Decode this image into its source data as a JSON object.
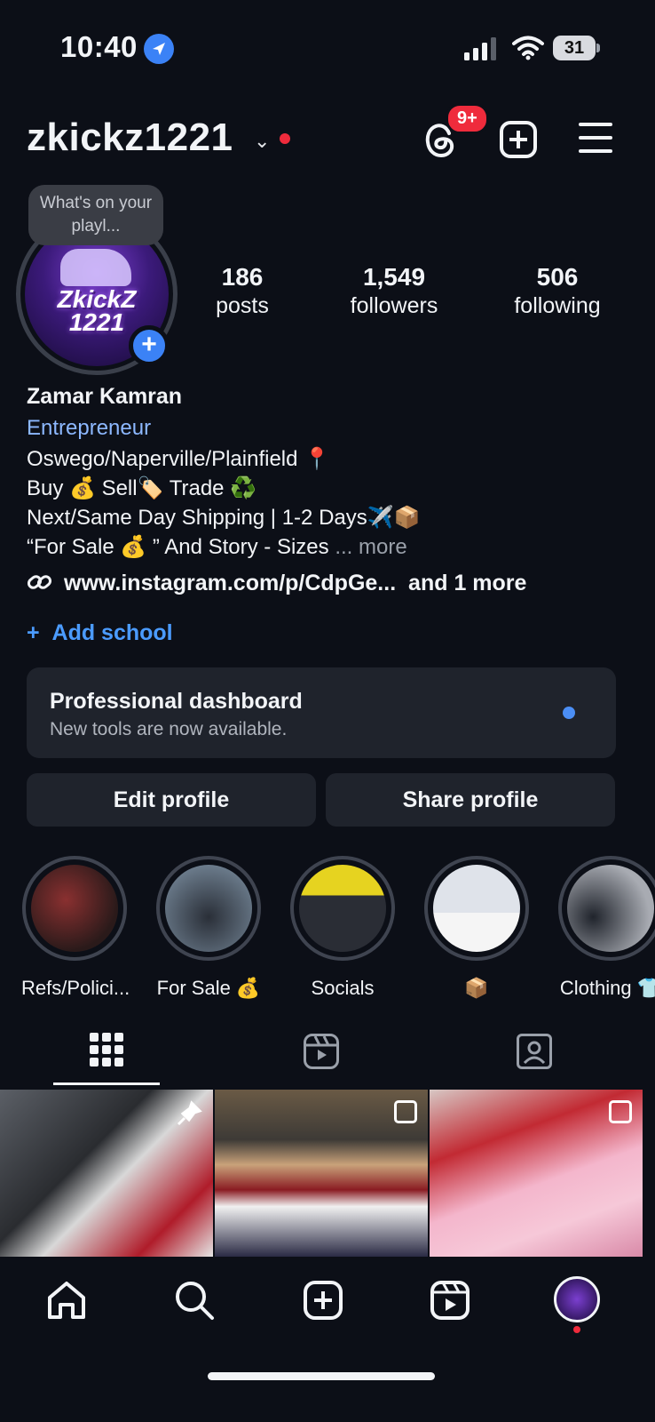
{
  "status_bar": {
    "time": "10:40",
    "battery": "31"
  },
  "header": {
    "username": "zkickz1221",
    "notification_badge": "9+"
  },
  "profile": {
    "note": "What's on your playl...",
    "avatar_text": "ZkickZ 1221",
    "stats": [
      {
        "value": "186",
        "label": "posts"
      },
      {
        "value": "1,549",
        "label": "followers"
      },
      {
        "value": "506",
        "label": "following"
      }
    ],
    "name": "Zamar Kamran",
    "category": "Entrepreneur",
    "bio_lines": [
      "Oswego/Naperville/Plainfield 📍",
      "Buy 💰 Sell🏷️ Trade ♻️",
      "Next/Same Day Shipping | 1-2 Days✈️📦"
    ],
    "bio_last": "“For Sale 💰 ” And Story - Sizes",
    "more_label": "... more",
    "link_text": "www.instagram.com/p/CdpGe...",
    "link_more": "and 1 more",
    "add_school": "Add school"
  },
  "dashboard": {
    "title": "Professional dashboard",
    "subtitle": "New tools are now available."
  },
  "buttons": {
    "edit": "Edit profile",
    "share": "Share profile"
  },
  "highlights": [
    {
      "label": "Refs/Polici...",
      "color": "#5a2a2a"
    },
    {
      "label": "For Sale 💰",
      "color": "#3a4a5a"
    },
    {
      "label": "Socials",
      "color": "#2e2e36"
    },
    {
      "label": "📦",
      "color": "#c9ccd3"
    },
    {
      "label": "Clothing 👕",
      "color": "#8a8d94"
    }
  ],
  "tabs": [
    "grid",
    "reels",
    "tagged"
  ],
  "posts": [
    {
      "name": "post-1",
      "pinned": true,
      "color": "#4a4a4a"
    },
    {
      "name": "post-2",
      "multiple": true,
      "color": "#5a4030"
    },
    {
      "name": "post-3",
      "multiple": true,
      "color": "#e8a0b8"
    }
  ],
  "nav": [
    "home-icon",
    "search-icon",
    "create-icon",
    "reels-icon",
    "profile-avatar"
  ]
}
